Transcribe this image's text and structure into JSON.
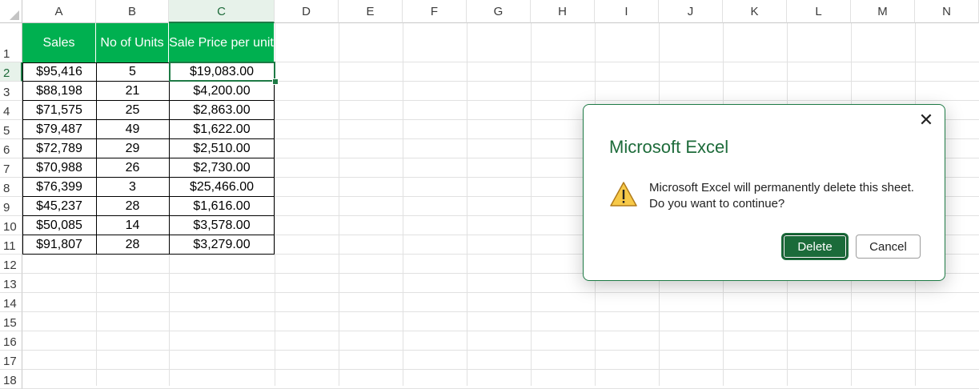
{
  "sheet": {
    "columns": [
      "A",
      "B",
      "C",
      "D",
      "E",
      "F",
      "G",
      "H",
      "I",
      "J",
      "K",
      "L",
      "M",
      "N"
    ],
    "rows": [
      "1",
      "2",
      "3",
      "4",
      "5",
      "6",
      "7",
      "8",
      "9",
      "10",
      "11",
      "12",
      "13",
      "14",
      "15",
      "16",
      "17",
      "18"
    ],
    "selected_column": "C",
    "selected_row": "2"
  },
  "table": {
    "header": [
      "Sales",
      "No of Units",
      "Sale Price per unit"
    ],
    "header_color": "#00b050",
    "rows": [
      [
        "$95,416",
        "5",
        "$19,083.00"
      ],
      [
        "$88,198",
        "21",
        "$4,200.00"
      ],
      [
        "$71,575",
        "25",
        "$2,863.00"
      ],
      [
        "$79,487",
        "49",
        "$1,622.00"
      ],
      [
        "$72,789",
        "29",
        "$2,510.00"
      ],
      [
        "$70,988",
        "26",
        "$2,730.00"
      ],
      [
        "$76,399",
        "3",
        "$25,466.00"
      ],
      [
        "$45,237",
        "28",
        "$1,616.00"
      ],
      [
        "$50,085",
        "14",
        "$3,578.00"
      ],
      [
        "$91,807",
        "28",
        "$3,279.00"
      ]
    ]
  },
  "dialog": {
    "title": "Microsoft Excel",
    "message_line1": "Microsoft Excel will permanently delete this sheet.",
    "message_line2": "Do you want to continue?",
    "close_glyph": "✕",
    "warning_icon": "warning-triangle",
    "delete_label": "Delete",
    "cancel_label": "Cancel",
    "accent_color": "#1d6b3a"
  }
}
